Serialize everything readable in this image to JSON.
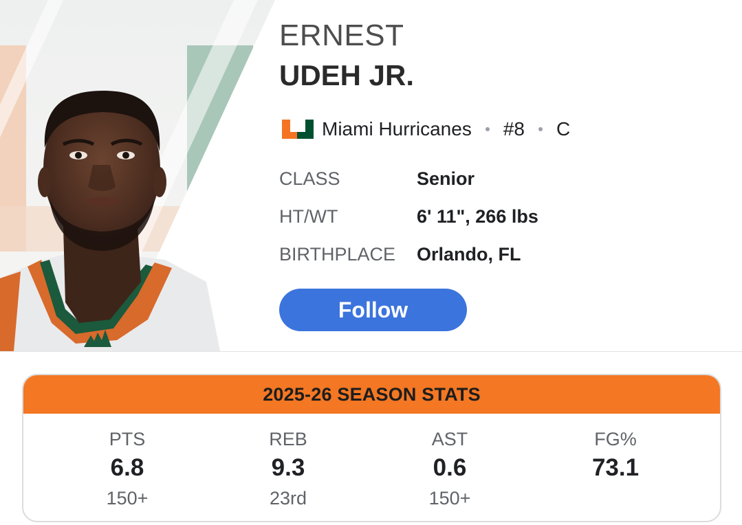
{
  "player": {
    "first_name": "ERNEST",
    "last_name": "UDEH JR.",
    "photo_icon": "player-headshot"
  },
  "team": {
    "logo_icon": "miami-u-logo",
    "name": "Miami Hurricanes",
    "number": "#8",
    "position": "C",
    "colors": {
      "orange": "#f47423",
      "green": "#005030"
    }
  },
  "bio": [
    {
      "label": "CLASS",
      "value": "Senior"
    },
    {
      "label": "HT/WT",
      "value": "6' 11\", 266 lbs"
    },
    {
      "label": "BIRTHPLACE",
      "value": "Orlando, FL"
    }
  ],
  "follow_button": {
    "label": "Follow",
    "color": "#3b74dd"
  },
  "stats": {
    "title": "2025-26 SEASON STATS",
    "header_color": "#f47723",
    "items": [
      {
        "label": "PTS",
        "value": "6.8",
        "rank": "150+"
      },
      {
        "label": "REB",
        "value": "9.3",
        "rank": "23rd"
      },
      {
        "label": "AST",
        "value": "0.6",
        "rank": "150+"
      },
      {
        "label": "FG%",
        "value": "73.1",
        "rank": ""
      }
    ]
  }
}
